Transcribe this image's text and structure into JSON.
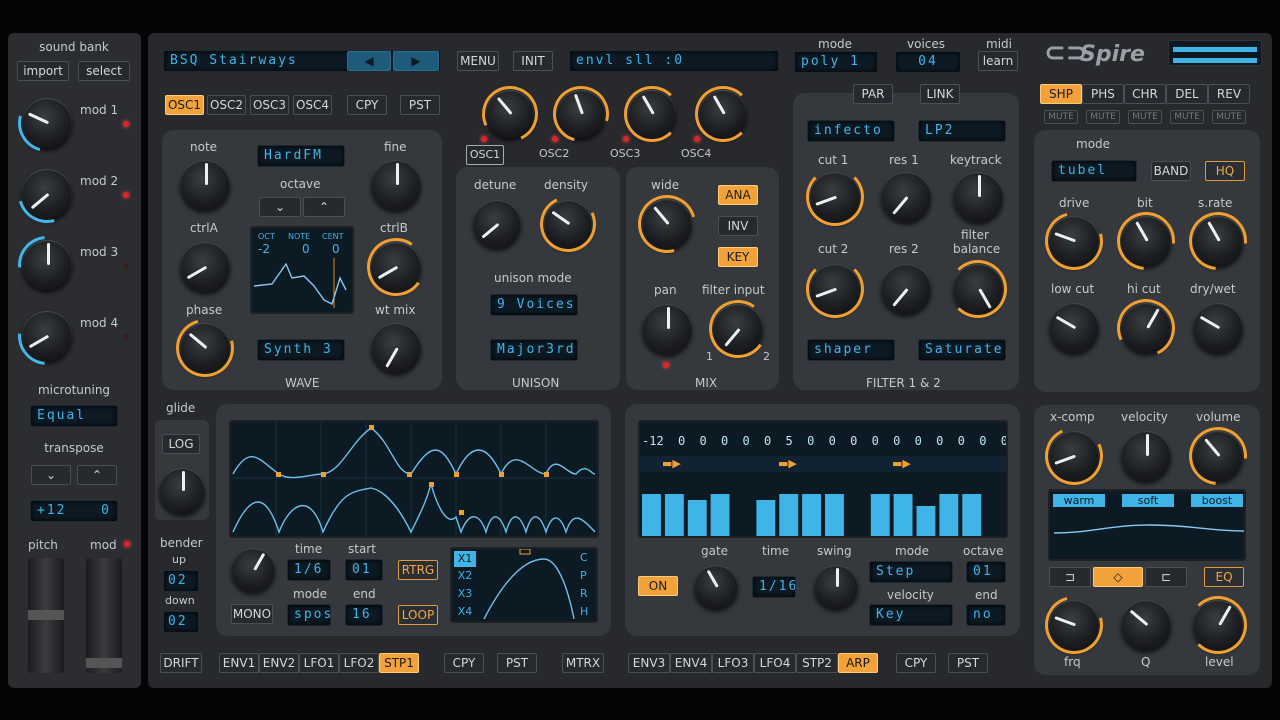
{
  "sound_bank": {
    "title": "sound bank",
    "import": "import",
    "select": "select"
  },
  "mods": [
    "mod 1",
    "mod 2",
    "mod 3",
    "mod 4"
  ],
  "microtuning": {
    "title": "microtuning",
    "value": "Equal"
  },
  "transpose": {
    "title": "transpose",
    "value": "+12",
    "value2": "0"
  },
  "wheels": {
    "pitch": "pitch",
    "mod": "mod"
  },
  "top": {
    "preset": "BSQ Stairways",
    "menu": "MENU",
    "init": "INIT",
    "display": "envl sll         :0",
    "mode_label": "mode",
    "mode_value": "poly 1",
    "voices_label": "voices",
    "voices_value": "04",
    "midi_label": "midi",
    "midi_value": "learn",
    "logo": "Spire"
  },
  "osc_tabs": [
    "OSC1",
    "OSC2",
    "OSC3",
    "OSC4"
  ],
  "osc_cpy": "CPY",
  "osc_pst": "PST",
  "osc_mix_labels": [
    "OSC1",
    "OSC2",
    "OSC3",
    "OSC4"
  ],
  "wave": {
    "note": "note",
    "fine": "fine",
    "octave": "octave",
    "mode_value": "HardFM",
    "ctrlA": "ctrlA",
    "ctrlB": "ctrlB",
    "phase": "phase",
    "wtmix": "wt mix",
    "wave_value": "Synth 3",
    "title": "WAVE",
    "oct": "OCT",
    "note_h": "NOTE",
    "cent": "CENT",
    "oct_v": "-2",
    "note_v": "0",
    "cent_v": "0"
  },
  "unison": {
    "detune": "detune",
    "density": "density",
    "mode_label": "unison mode",
    "voices": "9 Voices",
    "chord": "Major3rd",
    "title": "UNISON"
  },
  "mix": {
    "wide": "wide",
    "ana": "ANA",
    "inv": "INV",
    "key": "KEY",
    "pan": "pan",
    "filter_input": "filter input",
    "one": "1",
    "two": "2",
    "title": "MIX"
  },
  "filter": {
    "par": "PAR",
    "link": "LINK",
    "type1": "infecto",
    "type2": "LP2",
    "cut1": "cut 1",
    "res1": "res 1",
    "keytrack": "keytrack",
    "cut2": "cut 2",
    "res2": "res 2",
    "balance1": "filter",
    "balance2": "balance",
    "mode1": "shaper",
    "mode2": "Saturate",
    "title": "FILTER 1 & 2"
  },
  "fx_tabs": [
    "SHP",
    "PHS",
    "CHR",
    "DEL",
    "REV"
  ],
  "fx_mute": "MUTE",
  "fx": {
    "mode": "mode",
    "mode_value": "tubel",
    "band": "BAND",
    "hq": "HQ",
    "drive": "drive",
    "bit": "bit",
    "srate": "s.rate",
    "lowcut": "low cut",
    "hicut": "hi cut",
    "drywet": "dry/wet"
  },
  "eq": {
    "xcomp": "x-comp",
    "velocity": "velocity",
    "volume": "volume",
    "warm": "warm",
    "soft": "soft",
    "boost": "boost",
    "eq": "EQ",
    "frq": "frq",
    "q": "Q",
    "level": "level"
  },
  "glide": {
    "title": "glide",
    "log": "LOG"
  },
  "bender": {
    "title": "bender",
    "up": "up",
    "up_v": "02",
    "down": "down",
    "down_v": "02"
  },
  "env": {
    "mono": "MONO",
    "time": "time",
    "time_v": "1/6",
    "start": "start",
    "start_v": "01",
    "rtrg": "RTRG",
    "mode": "mode",
    "mode_v": "spos",
    "end": "end",
    "end_v": "16",
    "loop": "LOOP",
    "x": [
      "X1",
      "X2",
      "X3",
      "X4"
    ],
    "r": [
      "C",
      "P",
      "R",
      "H"
    ]
  },
  "step": {
    "values": [
      "-12",
      "0",
      "0",
      "0",
      "0",
      "0",
      "5",
      "0",
      "0",
      "0",
      "0",
      "0",
      "0",
      "0",
      "0",
      "0",
      "0"
    ],
    "bars": [
      0.7,
      0.7,
      0.6,
      0.7,
      0,
      0.6,
      0.7,
      0.7,
      0.7,
      0,
      0.7,
      0.7,
      0.5,
      0.7,
      0.7,
      0
    ],
    "on": "ON",
    "gate": "gate",
    "time": "time",
    "time_v": "1/16",
    "swing": "swing",
    "mode": "mode",
    "mode_v": "Step",
    "octave": "octave",
    "octave_v": "01",
    "velocity": "velocity",
    "velocity_v": "Key",
    "end": "end",
    "end_v": "no"
  },
  "bottom_left": [
    "ENV1",
    "ENV2",
    "LFO1",
    "LFO2",
    "STP1"
  ],
  "bottom_right": [
    "ENV3",
    "ENV4",
    "LFO3",
    "LFO4",
    "STP2",
    "ARP"
  ],
  "drift": "DRIFT",
  "cpy": "CPY",
  "pst": "PST",
  "mtrx": "MTRX",
  "colors": {
    "accent": "#f2a23a",
    "lcd": "#3fb4e6",
    "panel": "#35383d"
  }
}
